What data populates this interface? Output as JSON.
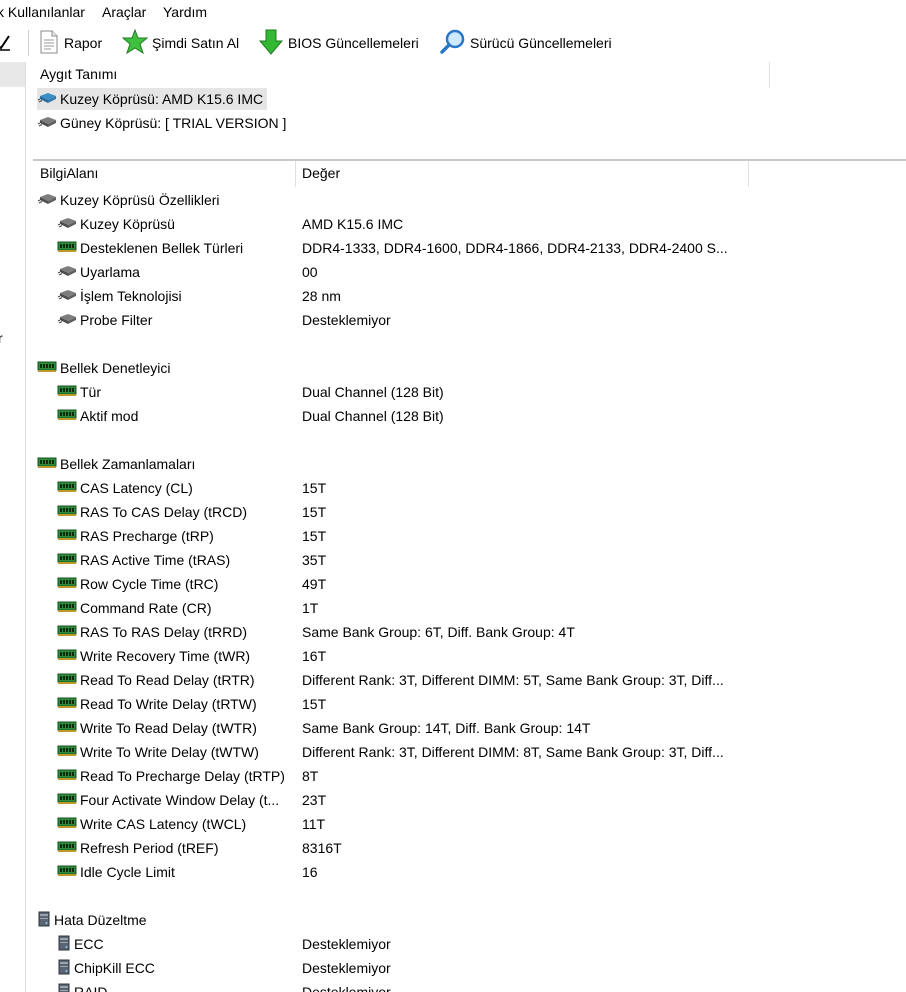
{
  "menubar": {
    "items": [
      "k Kullanılanlar",
      "Araçlar",
      "Yardım"
    ]
  },
  "toolbar": {
    "rapor": "Rapor",
    "satin_al": "Şimdi Satın Al",
    "bios": "BIOS Güncellemeleri",
    "surucu": "Sürücü Güncellemeleri"
  },
  "left_pane": {
    "fragment": "r"
  },
  "device_panel": {
    "header": "Aygıt Tanımı",
    "devices": [
      {
        "label": "Kuzey Köprüsü: AMD K15.6 IMC",
        "icon": "chip-icon",
        "selected": true
      },
      {
        "label": "Güney Köprüsü: [ TRIAL VERSION ]",
        "icon": "chip-icon",
        "selected": false
      }
    ]
  },
  "info_panel": {
    "headers": {
      "field": "BilgiAlanı",
      "value": "Değer"
    },
    "rows": [
      {
        "type": "section",
        "icon": "chip",
        "field": "Kuzey Köprüsü Özellikleri",
        "value": ""
      },
      {
        "type": "item",
        "icon": "chip",
        "field": "Kuzey Köprüsü",
        "value": "AMD K15.6 IMC"
      },
      {
        "type": "item",
        "icon": "ram",
        "field": "Desteklenen Bellek Türleri",
        "value": "DDR4-1333, DDR4-1600, DDR4-1866, DDR4-2133, DDR4-2400 S..."
      },
      {
        "type": "item",
        "icon": "chip",
        "field": "Uyarlama",
        "value": "00"
      },
      {
        "type": "item",
        "icon": "chip",
        "field": "İşlem Teknolojisi",
        "value": "28 nm"
      },
      {
        "type": "item",
        "icon": "chip",
        "field": "Probe Filter",
        "value": "Desteklemiyor"
      },
      {
        "type": "blank"
      },
      {
        "type": "section",
        "icon": "ram",
        "field": "Bellek Denetleyici",
        "value": ""
      },
      {
        "type": "item",
        "icon": "ram",
        "field": "Tür",
        "value": "Dual Channel  (128 Bit)"
      },
      {
        "type": "item",
        "icon": "ram",
        "field": "Aktif mod",
        "value": "Dual Channel  (128 Bit)"
      },
      {
        "type": "blank"
      },
      {
        "type": "section",
        "icon": "ram",
        "field": "Bellek Zamanlamaları",
        "value": ""
      },
      {
        "type": "item",
        "icon": "ram",
        "field": "CAS Latency (CL)",
        "value": "15T"
      },
      {
        "type": "item",
        "icon": "ram",
        "field": "RAS To CAS Delay (tRCD)",
        "value": "15T"
      },
      {
        "type": "item",
        "icon": "ram",
        "field": "RAS Precharge (tRP)",
        "value": "15T"
      },
      {
        "type": "item",
        "icon": "ram",
        "field": "RAS Active Time (tRAS)",
        "value": "35T"
      },
      {
        "type": "item",
        "icon": "ram",
        "field": "Row Cycle Time (tRC)",
        "value": "49T"
      },
      {
        "type": "item",
        "icon": "ram",
        "field": "Command Rate (CR)",
        "value": "1T"
      },
      {
        "type": "item",
        "icon": "ram",
        "field": "RAS To RAS Delay (tRRD)",
        "value": "Same Bank Group: 6T, Diff. Bank Group: 4T"
      },
      {
        "type": "item",
        "icon": "ram",
        "field": "Write Recovery Time (tWR)",
        "value": "16T"
      },
      {
        "type": "item",
        "icon": "ram",
        "field": "Read To Read Delay (tRTR)",
        "value": "Different Rank: 3T, Different DIMM: 5T, Same Bank Group: 3T, Diff..."
      },
      {
        "type": "item",
        "icon": "ram",
        "field": "Read To Write Delay (tRTW)",
        "value": "15T"
      },
      {
        "type": "item",
        "icon": "ram",
        "field": "Write To Read Delay (tWTR)",
        "value": "Same Bank Group: 14T, Diff. Bank Group: 14T"
      },
      {
        "type": "item",
        "icon": "ram",
        "field": "Write To Write Delay (tWTW)",
        "value": "Different Rank: 3T, Different DIMM: 8T, Same Bank Group: 3T, Diff..."
      },
      {
        "type": "item",
        "icon": "ram",
        "field": "Read To Precharge Delay (tRTP)",
        "value": "8T"
      },
      {
        "type": "item",
        "icon": "ram",
        "field": "Four Activate Window Delay (t...",
        "value": "23T"
      },
      {
        "type": "item",
        "icon": "ram",
        "field": "Write CAS Latency (tWCL)",
        "value": "11T"
      },
      {
        "type": "item",
        "icon": "ram",
        "field": "Refresh Period (tREF)",
        "value": "8316T"
      },
      {
        "type": "item",
        "icon": "ram",
        "field": "Idle Cycle Limit",
        "value": "16"
      },
      {
        "type": "blank"
      },
      {
        "type": "section",
        "icon": "server",
        "field": "Hata Düzeltme",
        "value": ""
      },
      {
        "type": "item",
        "icon": "server",
        "field": "ECC",
        "value": "Desteklemiyor"
      },
      {
        "type": "item",
        "icon": "server",
        "field": "ChipKill ECC",
        "value": "Desteklemiyor"
      },
      {
        "type": "item",
        "icon": "server",
        "field": "RAID",
        "value": "Desteklemiyor"
      }
    ]
  }
}
